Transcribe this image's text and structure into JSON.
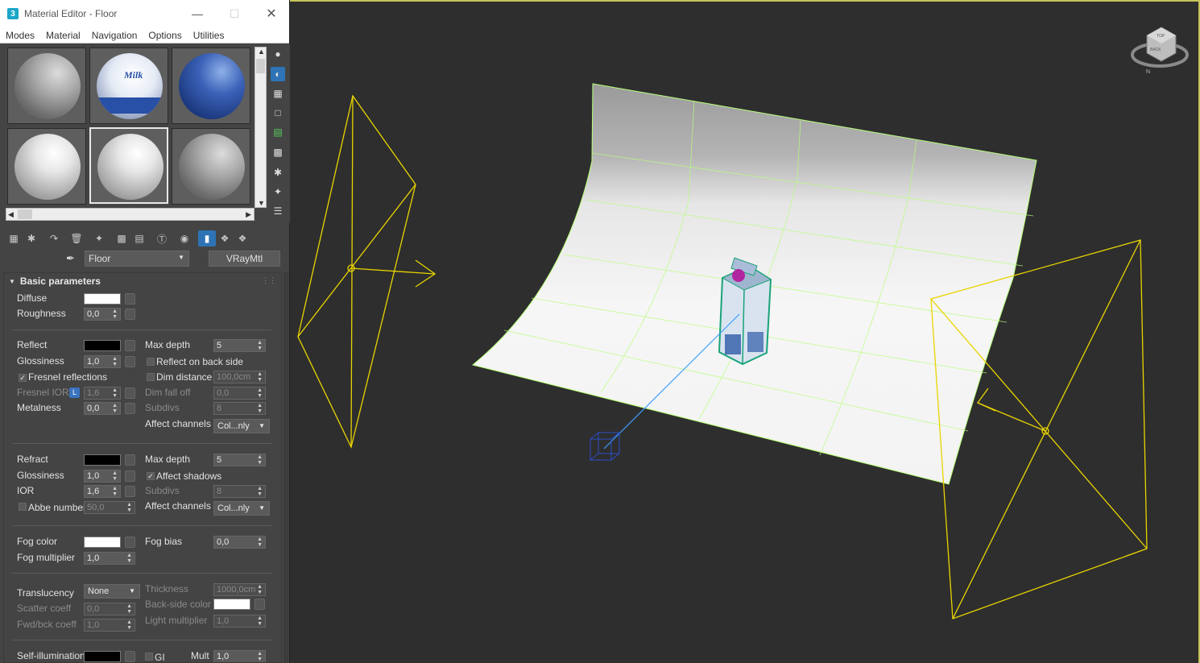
{
  "window": {
    "icon_text": "3",
    "title": "Material Editor - Floor"
  },
  "menu": [
    "Modes",
    "Material",
    "Navigation",
    "Options",
    "Utilities"
  ],
  "material": {
    "name": "Floor",
    "type": "VRayMtl"
  },
  "slots": [
    {
      "kind": "grey"
    },
    {
      "kind": "milk",
      "label": "Milk"
    },
    {
      "kind": "blue"
    },
    {
      "kind": "white"
    },
    {
      "kind": "white-active"
    },
    {
      "kind": "grey"
    }
  ],
  "rollout": {
    "title": "Basic parameters"
  },
  "basic": {
    "diffuse": {
      "label": "Diffuse",
      "color": "#ffffff"
    },
    "roughness": {
      "label": "Roughness",
      "value": "0,0"
    }
  },
  "reflect": {
    "label": "Reflect",
    "color": "#000000",
    "glossiness": {
      "label": "Glossiness",
      "value": "1,0"
    },
    "fresnel": {
      "label": "Fresnel reflections",
      "checked": true
    },
    "fresnel_ior": {
      "label": "Fresnel IOR",
      "lock": "L",
      "value": "1,6"
    },
    "metalness": {
      "label": "Metalness",
      "value": "0,0"
    },
    "max_depth": {
      "label": "Max depth",
      "value": "5"
    },
    "back_side": {
      "label": "Reflect on back side"
    },
    "dim_distance": {
      "label": "Dim distance",
      "value": "100,0cm"
    },
    "dim_falloff": {
      "label": "Dim fall off",
      "value": "0,0"
    },
    "subdivs": {
      "label": "Subdivs",
      "value": "8"
    },
    "affect_channels": {
      "label": "Affect channels",
      "value": "Col...nly"
    }
  },
  "refract": {
    "label": "Refract",
    "color": "#000000",
    "glossiness": {
      "label": "Glossiness",
      "value": "1,0"
    },
    "ior": {
      "label": "IOR",
      "value": "1,6"
    },
    "abbe": {
      "label": "Abbe number",
      "value": "50,0"
    },
    "max_depth": {
      "label": "Max depth",
      "value": "5"
    },
    "affect_shadows": {
      "label": "Affect shadows",
      "checked": true
    },
    "subdivs": {
      "label": "Subdivs",
      "value": "8"
    },
    "affect_channels": {
      "label": "Affect channels",
      "value": "Col...nly"
    }
  },
  "fog": {
    "color": {
      "label": "Fog color",
      "color": "#ffffff"
    },
    "multiplier": {
      "label": "Fog multiplier",
      "value": "1,0"
    },
    "bias": {
      "label": "Fog bias",
      "value": "0,0"
    }
  },
  "translucency": {
    "label": "Translucency",
    "value": "None",
    "scatter": {
      "label": "Scatter coeff",
      "value": "0,0"
    },
    "fwd_bck": {
      "label": "Fwd/bck coeff",
      "value": "1,0"
    },
    "thickness": {
      "label": "Thickness",
      "value": "1000,0cm"
    },
    "back_side_color": {
      "label": "Back-side color",
      "color": "#ffffff"
    },
    "light_multiplier": {
      "label": "Light multiplier",
      "value": "1,0"
    }
  },
  "self_illum": {
    "label": "Self-illumination",
    "color": "#000000",
    "gi_label": "GI",
    "mult_label": "Mult",
    "mult_value": "1,0"
  },
  "viewcube": {
    "top": "TOP",
    "back": "BACK",
    "north": "N"
  },
  "colors": {
    "light_gizmo": "#e8d400",
    "viewport_bg": "#2e2e2e",
    "selection_edge": "#b8ff7a",
    "camera_target": "#2b4dc8"
  }
}
